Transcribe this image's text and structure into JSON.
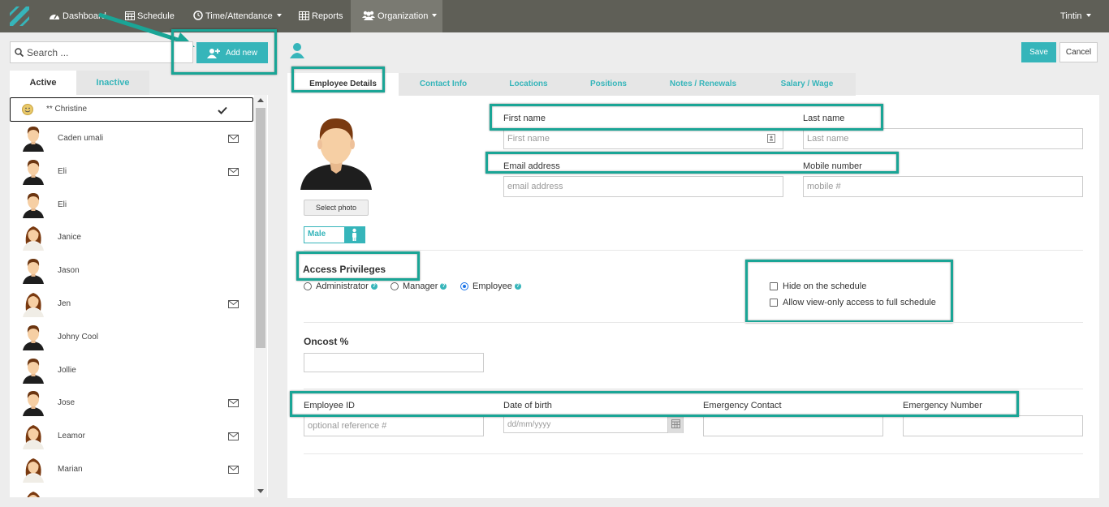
{
  "nav": {
    "dashboard": "Dashboard",
    "schedule": "Schedule",
    "time_attendance": "Time/Attendance",
    "reports": "Reports",
    "organization": "Organization",
    "user": "Tintin"
  },
  "sidebar": {
    "search_placeholder": "Search ...",
    "add_new": "Add new",
    "tab_active": "Active",
    "tab_inactive": "Inactive",
    "employees": [
      {
        "name": "** Christine",
        "avatar": "smiley-icon",
        "mail": false,
        "selected": true
      },
      {
        "name": "Caden umali",
        "avatar": "male",
        "mail": true
      },
      {
        "name": "Eli",
        "avatar": "male",
        "mail": true
      },
      {
        "name": "Eli",
        "avatar": "male",
        "mail": false
      },
      {
        "name": "Janice",
        "avatar": "female",
        "mail": false
      },
      {
        "name": "Jason",
        "avatar": "male",
        "mail": false
      },
      {
        "name": "Jen",
        "avatar": "female",
        "mail": true
      },
      {
        "name": "Johny Cool",
        "avatar": "male",
        "mail": false
      },
      {
        "name": "Jollie",
        "avatar": "male",
        "mail": false
      },
      {
        "name": "Jose",
        "avatar": "male",
        "mail": true
      },
      {
        "name": "Leamor",
        "avatar": "female",
        "mail": true
      },
      {
        "name": "Marian",
        "avatar": "female",
        "mail": true
      }
    ]
  },
  "toolbar": {
    "save": "Save",
    "cancel": "Cancel"
  },
  "tabs": [
    "Employee Details",
    "Contact Info",
    "Locations",
    "Positions",
    "Notes / Renewals",
    "Salary / Wage"
  ],
  "details": {
    "select_photo": "Select photo",
    "gender": "Male",
    "first_name_label": "First name",
    "first_name_placeholder": "First name",
    "last_name_label": "Last name",
    "last_name_placeholder": "Last name",
    "email_label": "Email address",
    "email_placeholder": "email address",
    "mobile_label": "Mobile number",
    "mobile_placeholder": "mobile #",
    "access_title": "Access Privileges",
    "role_admin": "Administrator",
    "role_manager": "Manager",
    "role_employee": "Employee",
    "selected_role": "Employee",
    "hide_schedule": "Hide on the schedule",
    "view_only": "Allow view-only access to full schedule",
    "oncost_title": "Oncost %",
    "employee_id_label": "Employee ID",
    "employee_id_placeholder": "optional reference #",
    "dob_label": "Date of birth",
    "dob_placeholder": "dd/mm/yyyy",
    "emergency_contact_label": "Emergency Contact",
    "emergency_number_label": "Emergency Number"
  },
  "colors": {
    "accent": "#36b5ba",
    "highlight": "#1aa596",
    "nav_bg": "#5f5f57"
  }
}
